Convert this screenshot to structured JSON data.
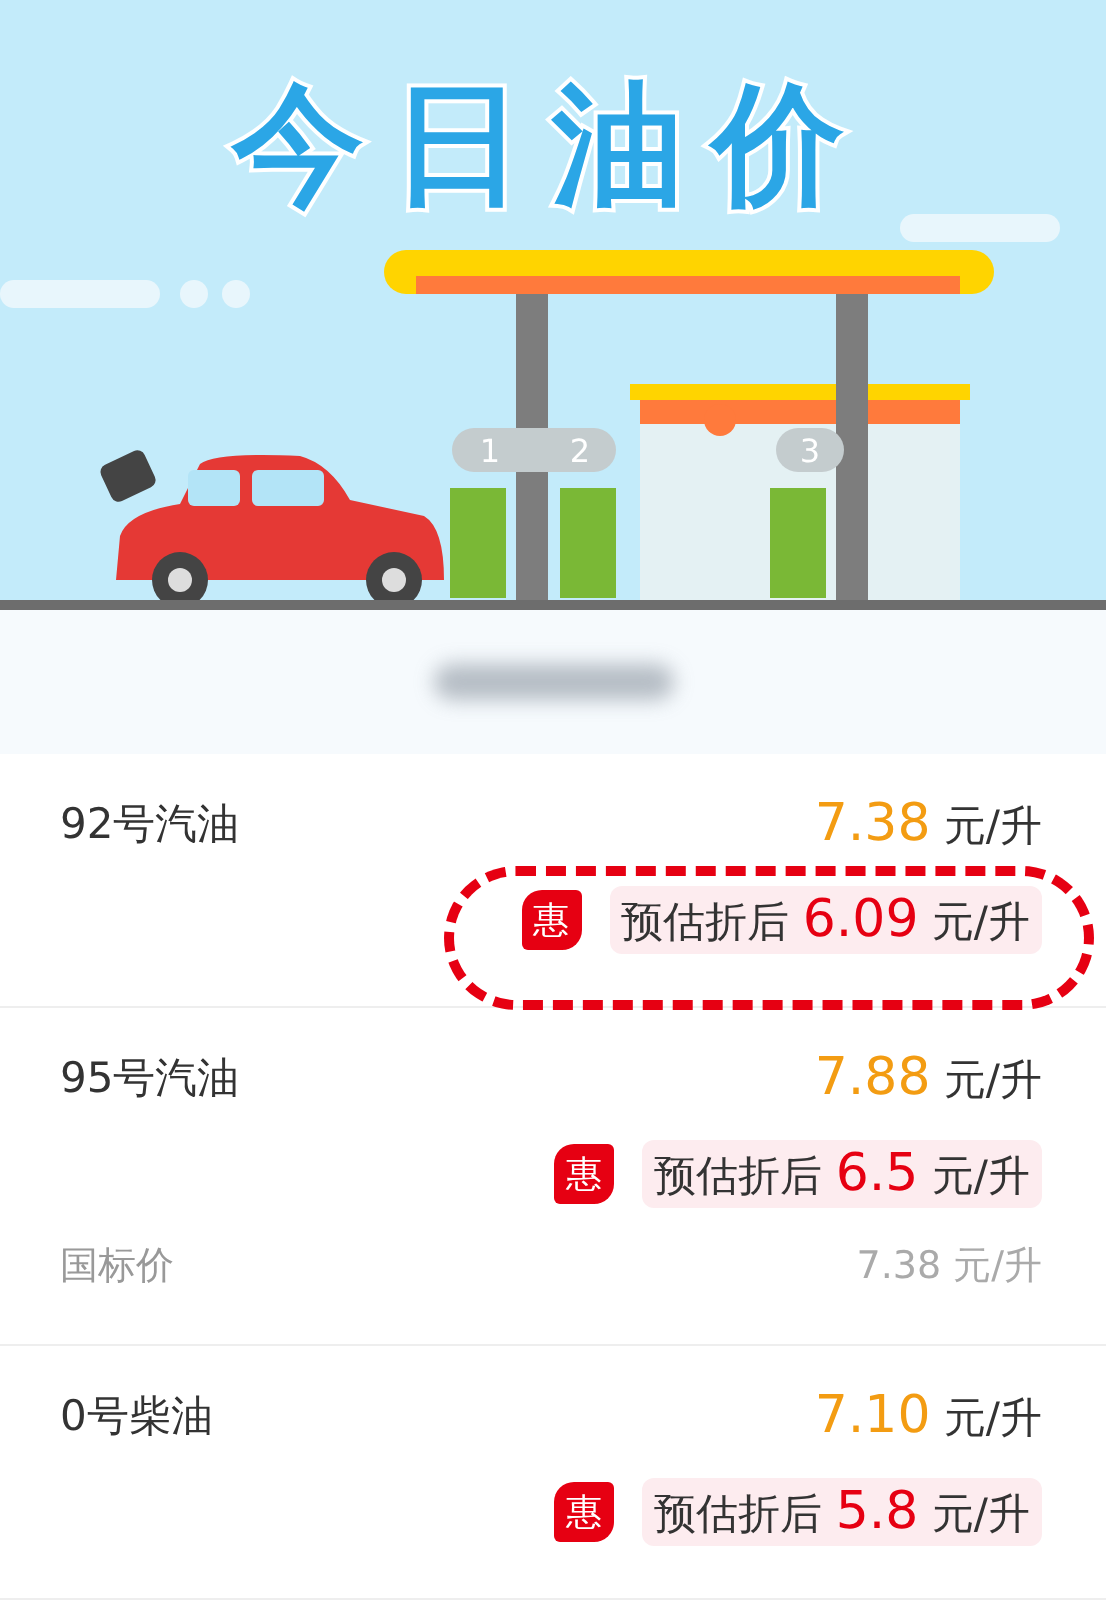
{
  "banner": {
    "title": "今日油价",
    "pump_numbers": [
      "1",
      "2",
      "3"
    ]
  },
  "fuels": [
    {
      "name": "92号汽油",
      "price": "7.38",
      "unit": "元/升",
      "discount": {
        "badge": "惠",
        "label": "预估折后",
        "price": "6.09",
        "unit": "元/升"
      },
      "highlighted": true
    },
    {
      "name": "95号汽油",
      "price": "7.88",
      "unit": "元/升",
      "discount": {
        "badge": "惠",
        "label": "预估折后",
        "price": "6.5",
        "unit": "元/升"
      },
      "highlighted": false,
      "reference": {
        "label": "国标价",
        "price": "7.38",
        "unit": "元/升"
      }
    },
    {
      "name": "0号柴油",
      "price": "7.10",
      "unit": "元/升",
      "discount": {
        "badge": "惠",
        "label": "预估折后",
        "price": "5.8",
        "unit": "元/升"
      },
      "highlighted": false
    }
  ]
}
